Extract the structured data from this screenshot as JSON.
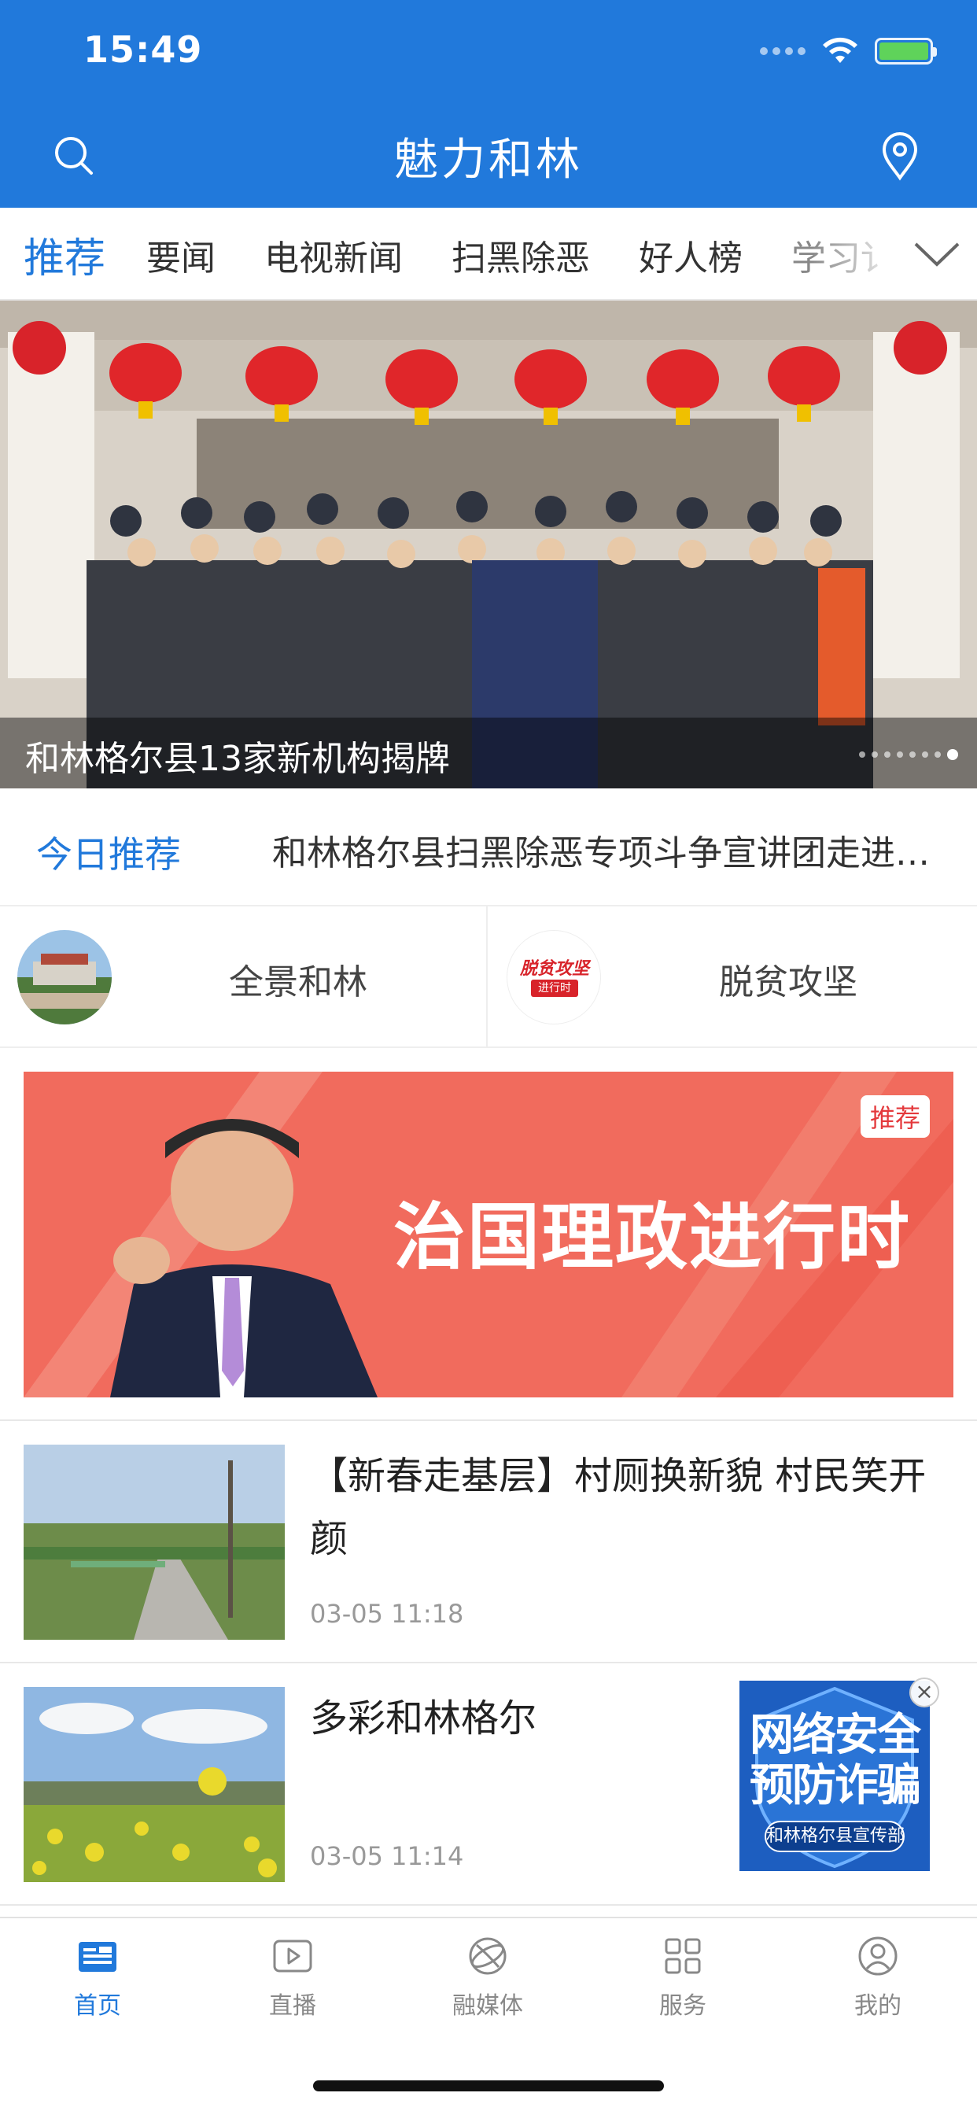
{
  "status_bar": {
    "time": "15:49",
    "icons": [
      "signal-icon",
      "wifi-icon",
      "battery-charging-icon"
    ]
  },
  "header": {
    "title": "魅力和林",
    "left_icon": "search-icon",
    "right_icon": "location-icon"
  },
  "tabs": {
    "items": [
      {
        "label": "推荐",
        "active": true
      },
      {
        "label": "要闻",
        "active": false
      },
      {
        "label": "电视新闻",
        "active": false
      },
      {
        "label": "扫黑除恶",
        "active": false
      },
      {
        "label": "好人榜",
        "active": false
      },
      {
        "label": "学习讠",
        "active": false
      }
    ],
    "more_icon": "chevron-down-icon"
  },
  "carousel": {
    "caption": "和林格尔县13家新机构揭牌"
  },
  "today": {
    "label": "今日推荐",
    "headline": "和林格尔县扫黑除恶专项斗争宣讲团走进…"
  },
  "shortcuts": [
    {
      "label": "全景和林"
    },
    {
      "label": "脱贫攻坚",
      "thumb_text": "脱贫攻坚",
      "thumb_sub": "进行时"
    }
  ],
  "banner": {
    "tag": "推荐",
    "title": "治国理政进行时"
  },
  "news": [
    {
      "title": "【新春走基层】村厕换新貌 村民笑开颜",
      "time": "03-05 11:18"
    },
    {
      "title": "多彩和林格尔",
      "time": "03-05 11:14"
    }
  ],
  "ad": {
    "line1": "网络安全",
    "line2": "预防诈骗",
    "footer": "和林格尔县宣传部",
    "close": "×"
  },
  "bottom_nav": [
    {
      "label": "首页",
      "icon": "home-news-icon",
      "active": true
    },
    {
      "label": "直播",
      "icon": "play-icon",
      "active": false
    },
    {
      "label": "融媒体",
      "icon": "globe-icon",
      "active": false
    },
    {
      "label": "服务",
      "icon": "grid-icon",
      "active": false
    },
    {
      "label": "我的",
      "icon": "user-icon",
      "active": false
    }
  ],
  "colors": {
    "brand": "#2179db",
    "banner_red": "#f06b5c",
    "text": "#222222",
    "muted": "#999999"
  }
}
